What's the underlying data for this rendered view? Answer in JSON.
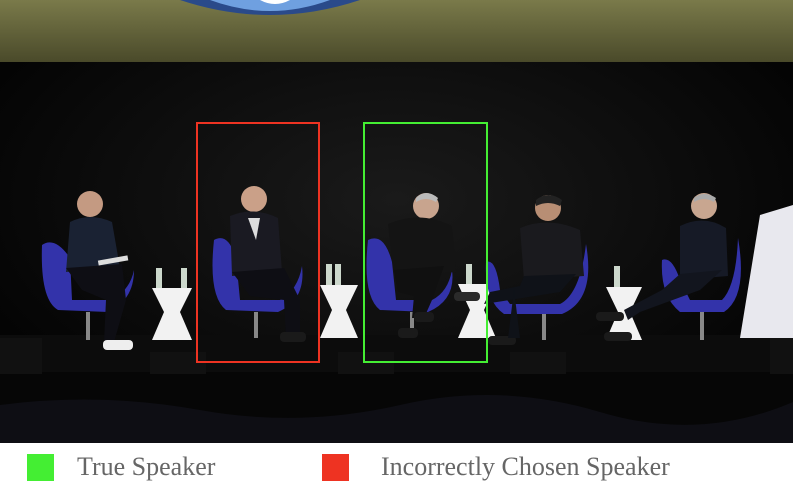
{
  "legend": {
    "true_speaker": {
      "label": "True Speaker",
      "color": "#44ee33"
    },
    "incorrect_speaker": {
      "label": "Incorrectly Chosen Speaker",
      "color": "#ee3322"
    }
  },
  "colors": {
    "stage_background": "#050505",
    "screen": "#6a6a3a",
    "chair": "#3333aa",
    "table": "#f2f2f2"
  }
}
